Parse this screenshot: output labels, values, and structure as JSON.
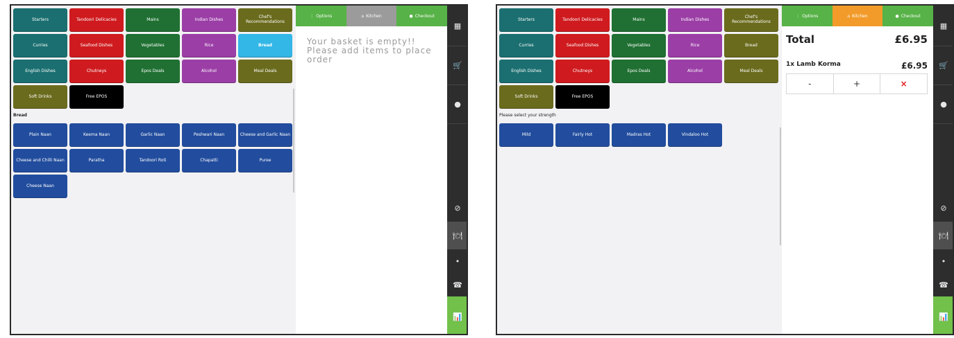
{
  "colors": {
    "teal": "#1b6f70",
    "red": "#cf1b1f",
    "green": "#1f7032",
    "purple": "#9b3ea6",
    "olive": "#6a6b1d",
    "skyblue": "#33b7e6",
    "blue": "#224d9e",
    "tab_green": "#57b247",
    "tab_orange": "#f29b2a",
    "sidebar": "#2d2d2d",
    "chart_green": "#72c14a"
  },
  "left": {
    "categories": [
      {
        "label": "Starters",
        "color": "teal"
      },
      {
        "label": "Tandoori Delicacies",
        "color": "red"
      },
      {
        "label": "Mains",
        "color": "green"
      },
      {
        "label": "Indian Dishes",
        "color": "purple"
      },
      {
        "label": "Chef's Recommendations",
        "color": "olive"
      },
      {
        "label": "Curries",
        "color": "teal"
      },
      {
        "label": "Seafood Dishes",
        "color": "red"
      },
      {
        "label": "Vegetables",
        "color": "green"
      },
      {
        "label": "Rice",
        "color": "purple"
      },
      {
        "label": "Bread",
        "color": "skyblue"
      },
      {
        "label": "English Dishes",
        "color": "teal"
      },
      {
        "label": "Chutneys",
        "color": "red"
      },
      {
        "label": "Epos Deals",
        "color": "green"
      },
      {
        "label": "Alcohol",
        "color": "purple"
      },
      {
        "label": "Meal Deals",
        "color": "olive"
      },
      {
        "label": "Soft Drinks",
        "color": "olive"
      },
      {
        "label": "Free EPOS",
        "color": "black"
      }
    ],
    "section_label": "Bread",
    "items": [
      "Plain Naan",
      "Keema Naan",
      "Garlic Naan",
      "Peshwari Naan",
      "Cheese and Garlic Naan",
      "Cheese and Chilli Naan",
      "Paratha",
      "Tandoori Roti",
      "Chapatti",
      "Puree",
      "Cheese Naan"
    ],
    "tabs": {
      "options": "Options",
      "kitchen": "Kitchen",
      "checkout": "Checkout"
    },
    "empty_message": "Your basket is empty!! Please add items to place order"
  },
  "right": {
    "categories": [
      {
        "label": "Starters",
        "color": "teal"
      },
      {
        "label": "Tandoori Delicacies",
        "color": "red"
      },
      {
        "label": "Mains",
        "color": "green"
      },
      {
        "label": "Indian Dishes",
        "color": "purple"
      },
      {
        "label": "Chef's Recommendations",
        "color": "olive"
      },
      {
        "label": "Curries",
        "color": "teal"
      },
      {
        "label": "Seafood Dishes",
        "color": "red"
      },
      {
        "label": "Vegetables",
        "color": "green"
      },
      {
        "label": "Rice",
        "color": "purple"
      },
      {
        "label": "Bread",
        "color": "olive"
      },
      {
        "label": "English Dishes",
        "color": "teal"
      },
      {
        "label": "Chutneys",
        "color": "red"
      },
      {
        "label": "Epos Deals",
        "color": "green"
      },
      {
        "label": "Alcohol",
        "color": "purple"
      },
      {
        "label": "Meal Deals",
        "color": "olive"
      },
      {
        "label": "Soft Drinks",
        "color": "olive"
      },
      {
        "label": "Free EPOS",
        "color": "black"
      }
    ],
    "prompt": "Please select your strength",
    "strengths": [
      "Mild",
      "Fairly Hot",
      "Madras Hot",
      "Vindaloo Hot"
    ],
    "tabs": {
      "options": "Options",
      "kitchen": "Kitchen",
      "checkout": "Checkout"
    },
    "total_label": "Total",
    "total_value": "£6.95",
    "line_item": {
      "name": "1x Lamb Korma",
      "price": "£6.95"
    },
    "qty": {
      "minus": "-",
      "plus": "+",
      "remove": "×"
    }
  },
  "sidebar_icons": {
    "grid": "▦",
    "cart": "🛒",
    "record": "●",
    "hidden": "⊘",
    "dining": "🍽",
    "dot": "•",
    "phone": "☎",
    "chart": "📊"
  }
}
